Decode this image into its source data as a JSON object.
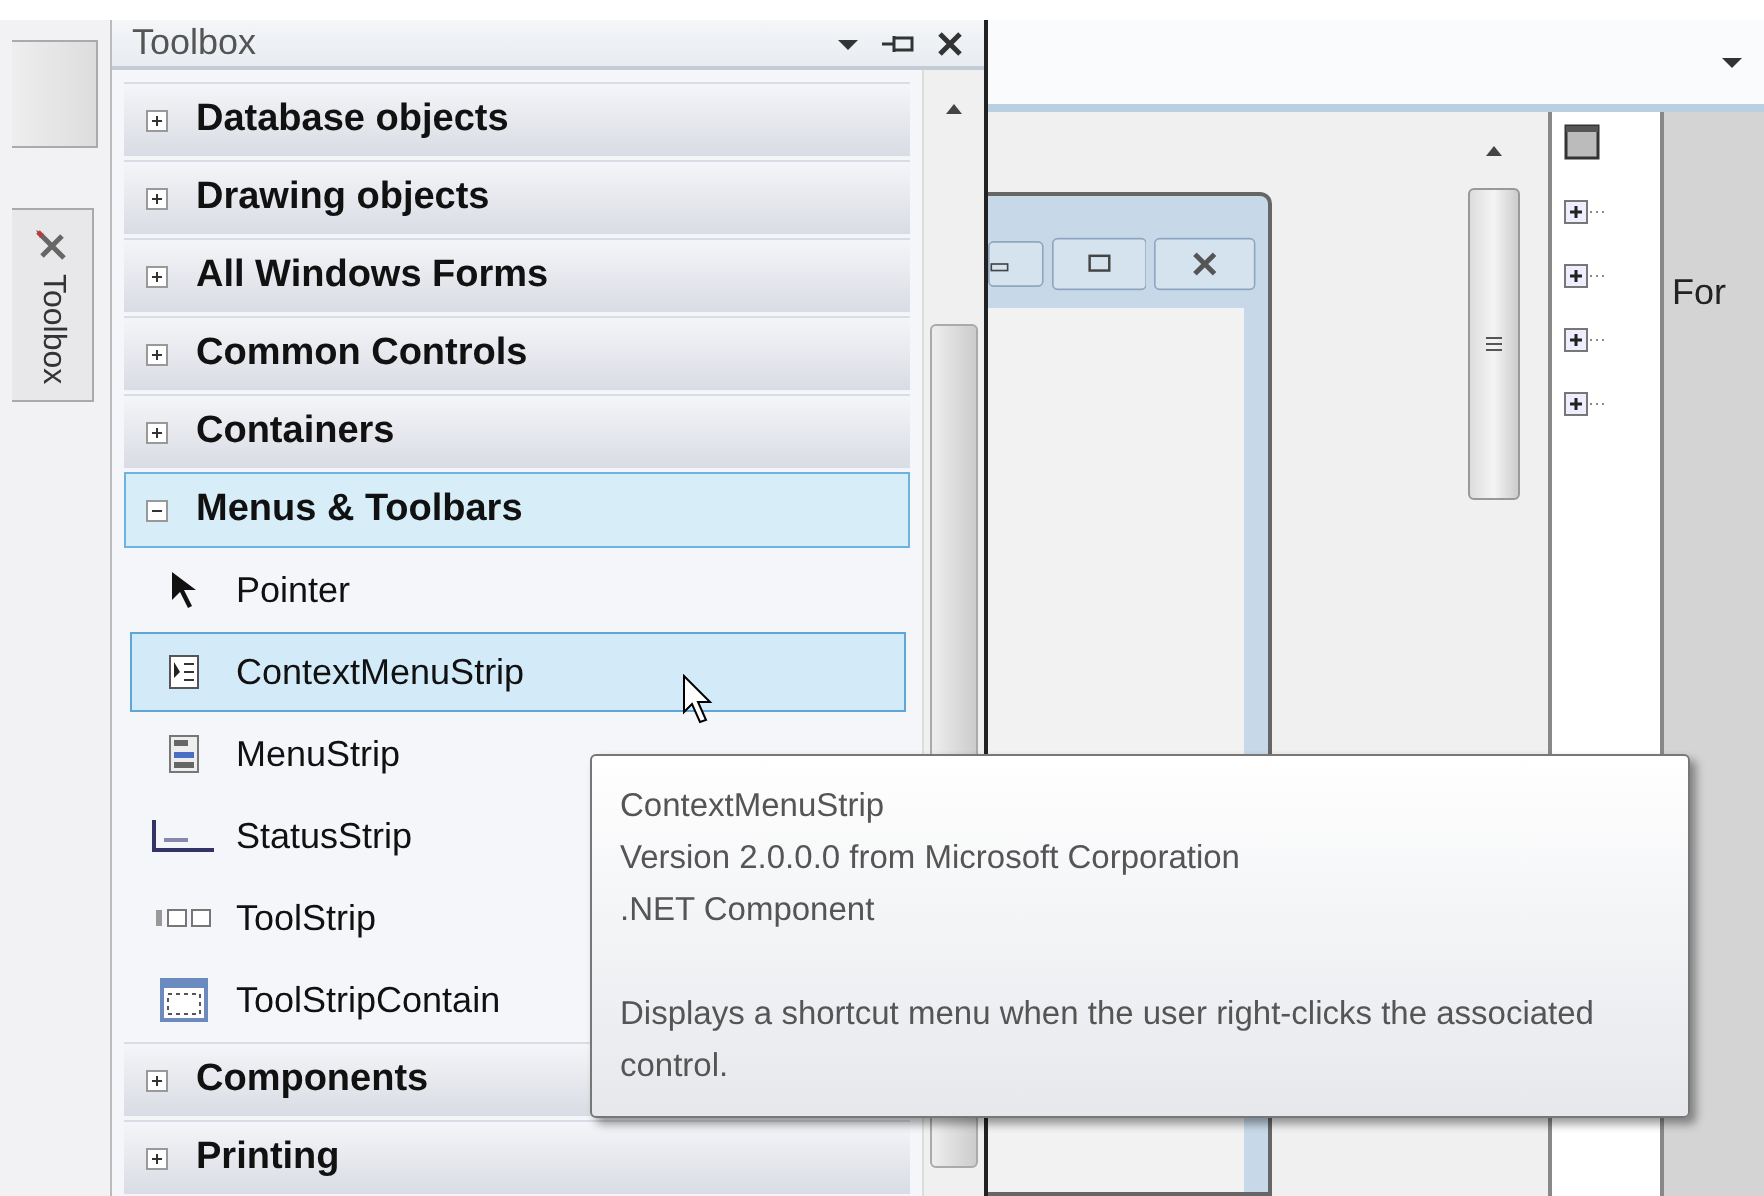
{
  "side_tab": {
    "label": "Toolbox"
  },
  "toolbox": {
    "title": "Toolbox",
    "categories": [
      {
        "label": "Database objects",
        "expanded": false
      },
      {
        "label": "Drawing objects",
        "expanded": false
      },
      {
        "label": "All Windows Forms",
        "expanded": false
      },
      {
        "label": "Common Controls",
        "expanded": false
      },
      {
        "label": "Containers",
        "expanded": false
      },
      {
        "label": "Menus & Toolbars",
        "expanded": true,
        "items": [
          {
            "label": "Pointer",
            "kind": "pointer",
            "selected": false
          },
          {
            "label": "ContextMenuStrip",
            "kind": "contextmenu",
            "selected": true
          },
          {
            "label": "MenuStrip",
            "kind": "menu",
            "selected": false
          },
          {
            "label": "StatusStrip",
            "kind": "status",
            "selected": false
          },
          {
            "label": "ToolStrip",
            "kind": "toolstrip",
            "selected": false
          },
          {
            "label": "ToolStripContain",
            "kind": "container",
            "selected": false
          }
        ]
      },
      {
        "label": "Components",
        "expanded": false
      },
      {
        "label": "Printing",
        "expanded": false
      }
    ]
  },
  "properties_panel": {
    "label": "For"
  },
  "tooltip": {
    "title": "ContextMenuStrip",
    "version": "Version 2.0.0.0 from Microsoft Corporation",
    "type": ".NET Component",
    "description": "Displays a shortcut menu when the user right-clicks the associated control."
  }
}
